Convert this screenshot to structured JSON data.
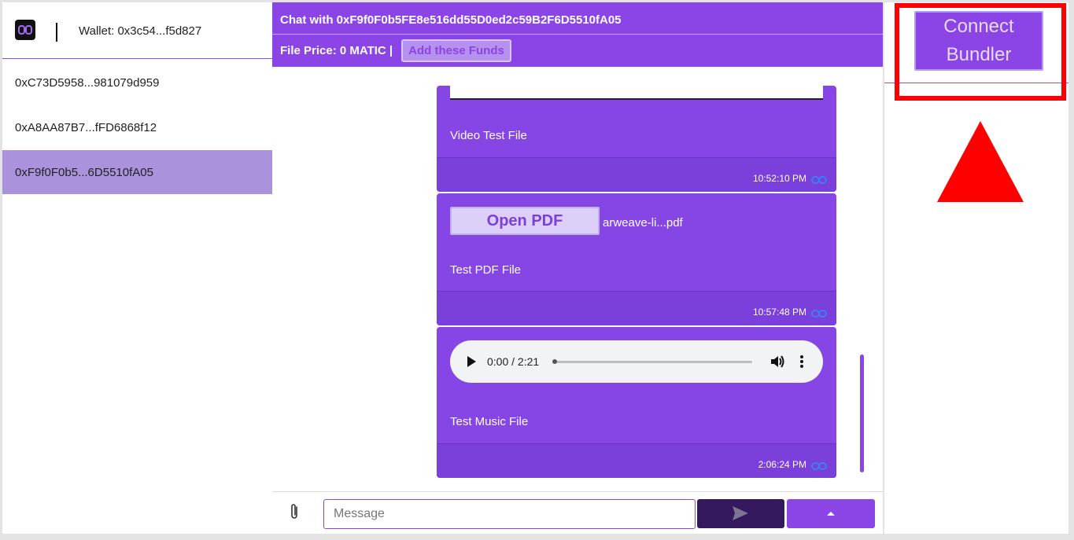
{
  "sidebar": {
    "wallet_label": "Wallet: 0x3c54...f5d827",
    "contacts": [
      {
        "label": "0xC73D5958...981079d959"
      },
      {
        "label": "0xA8AA87B7...fFD6868f12"
      },
      {
        "label": "0xF9f0F0b5...6D5510fA05",
        "active": true
      }
    ]
  },
  "chat": {
    "title": "Chat with 0xF9f0F0b5FE8e516dd55D0ed2c59B2F6D5510fA05",
    "file_price": "File Price: 0 MATIC |",
    "add_funds_label": "Add these Funds",
    "messages": [
      {
        "type": "video",
        "caption": "Video Test File",
        "time": "10:52:10 PM"
      },
      {
        "type": "pdf",
        "button_label": "Open PDF",
        "file_name": "arweave-li...pdf",
        "caption": "Test PDF File",
        "time": "10:57:48 PM"
      },
      {
        "type": "audio",
        "player_time": "0:00 / 2:21",
        "caption": "Test Music File",
        "time": "2:06:24 PM"
      }
    ],
    "composer": {
      "placeholder": "Message"
    }
  },
  "right_panel": {
    "connect_label_line1": "Connect",
    "connect_label_line2": "Bundler",
    "annotation_color": "#ff0000"
  },
  "colors": {
    "accent": "#8b44e6",
    "active_contact": "#ab92dc",
    "send_button": "#35195f"
  }
}
